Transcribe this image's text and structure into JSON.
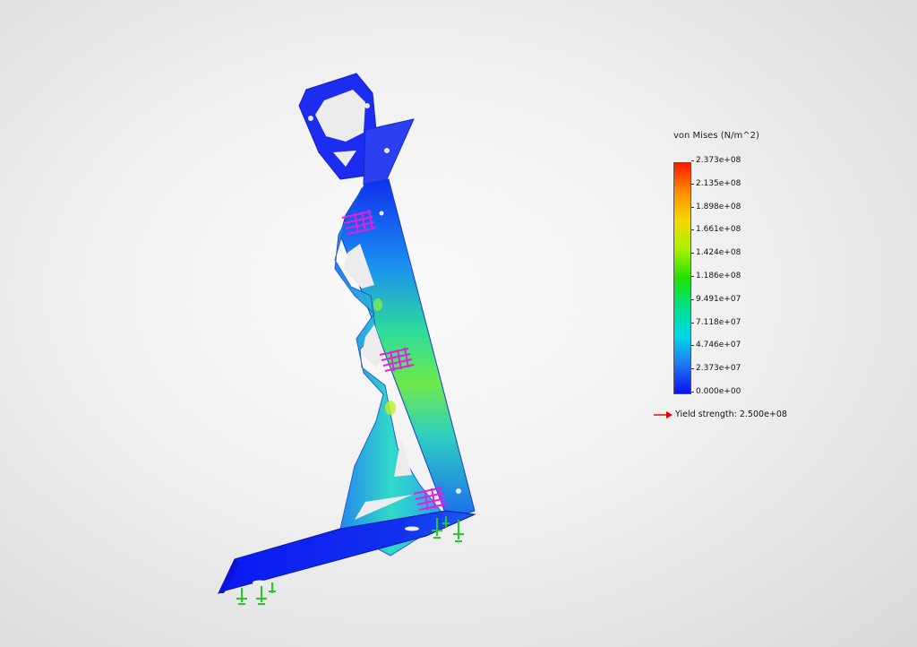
{
  "legend": {
    "title": "von Mises (N/m^2)",
    "ticks": [
      "2.373e+08",
      "2.135e+08",
      "1.898e+08",
      "1.661e+08",
      "1.424e+08",
      "1.186e+08",
      "9.491e+07",
      "7.118e+07",
      "4.746e+07",
      "2.373e+07",
      "0.000e+00"
    ],
    "colormap": [
      "#ff1a00",
      "#ff8c00",
      "#f5d800",
      "#a8f000",
      "#22e000",
      "#00e08a",
      "#00d8e8",
      "#1f78f0",
      "#0a10f5"
    ],
    "yield_text": "Yield strength: 2.500e+08",
    "yield_arrow_color": "#e00000"
  },
  "model": {
    "part_base_color": "#1e3cf0",
    "load_arrow_color": "#e020e0",
    "fixture_color": "#22cc22"
  }
}
